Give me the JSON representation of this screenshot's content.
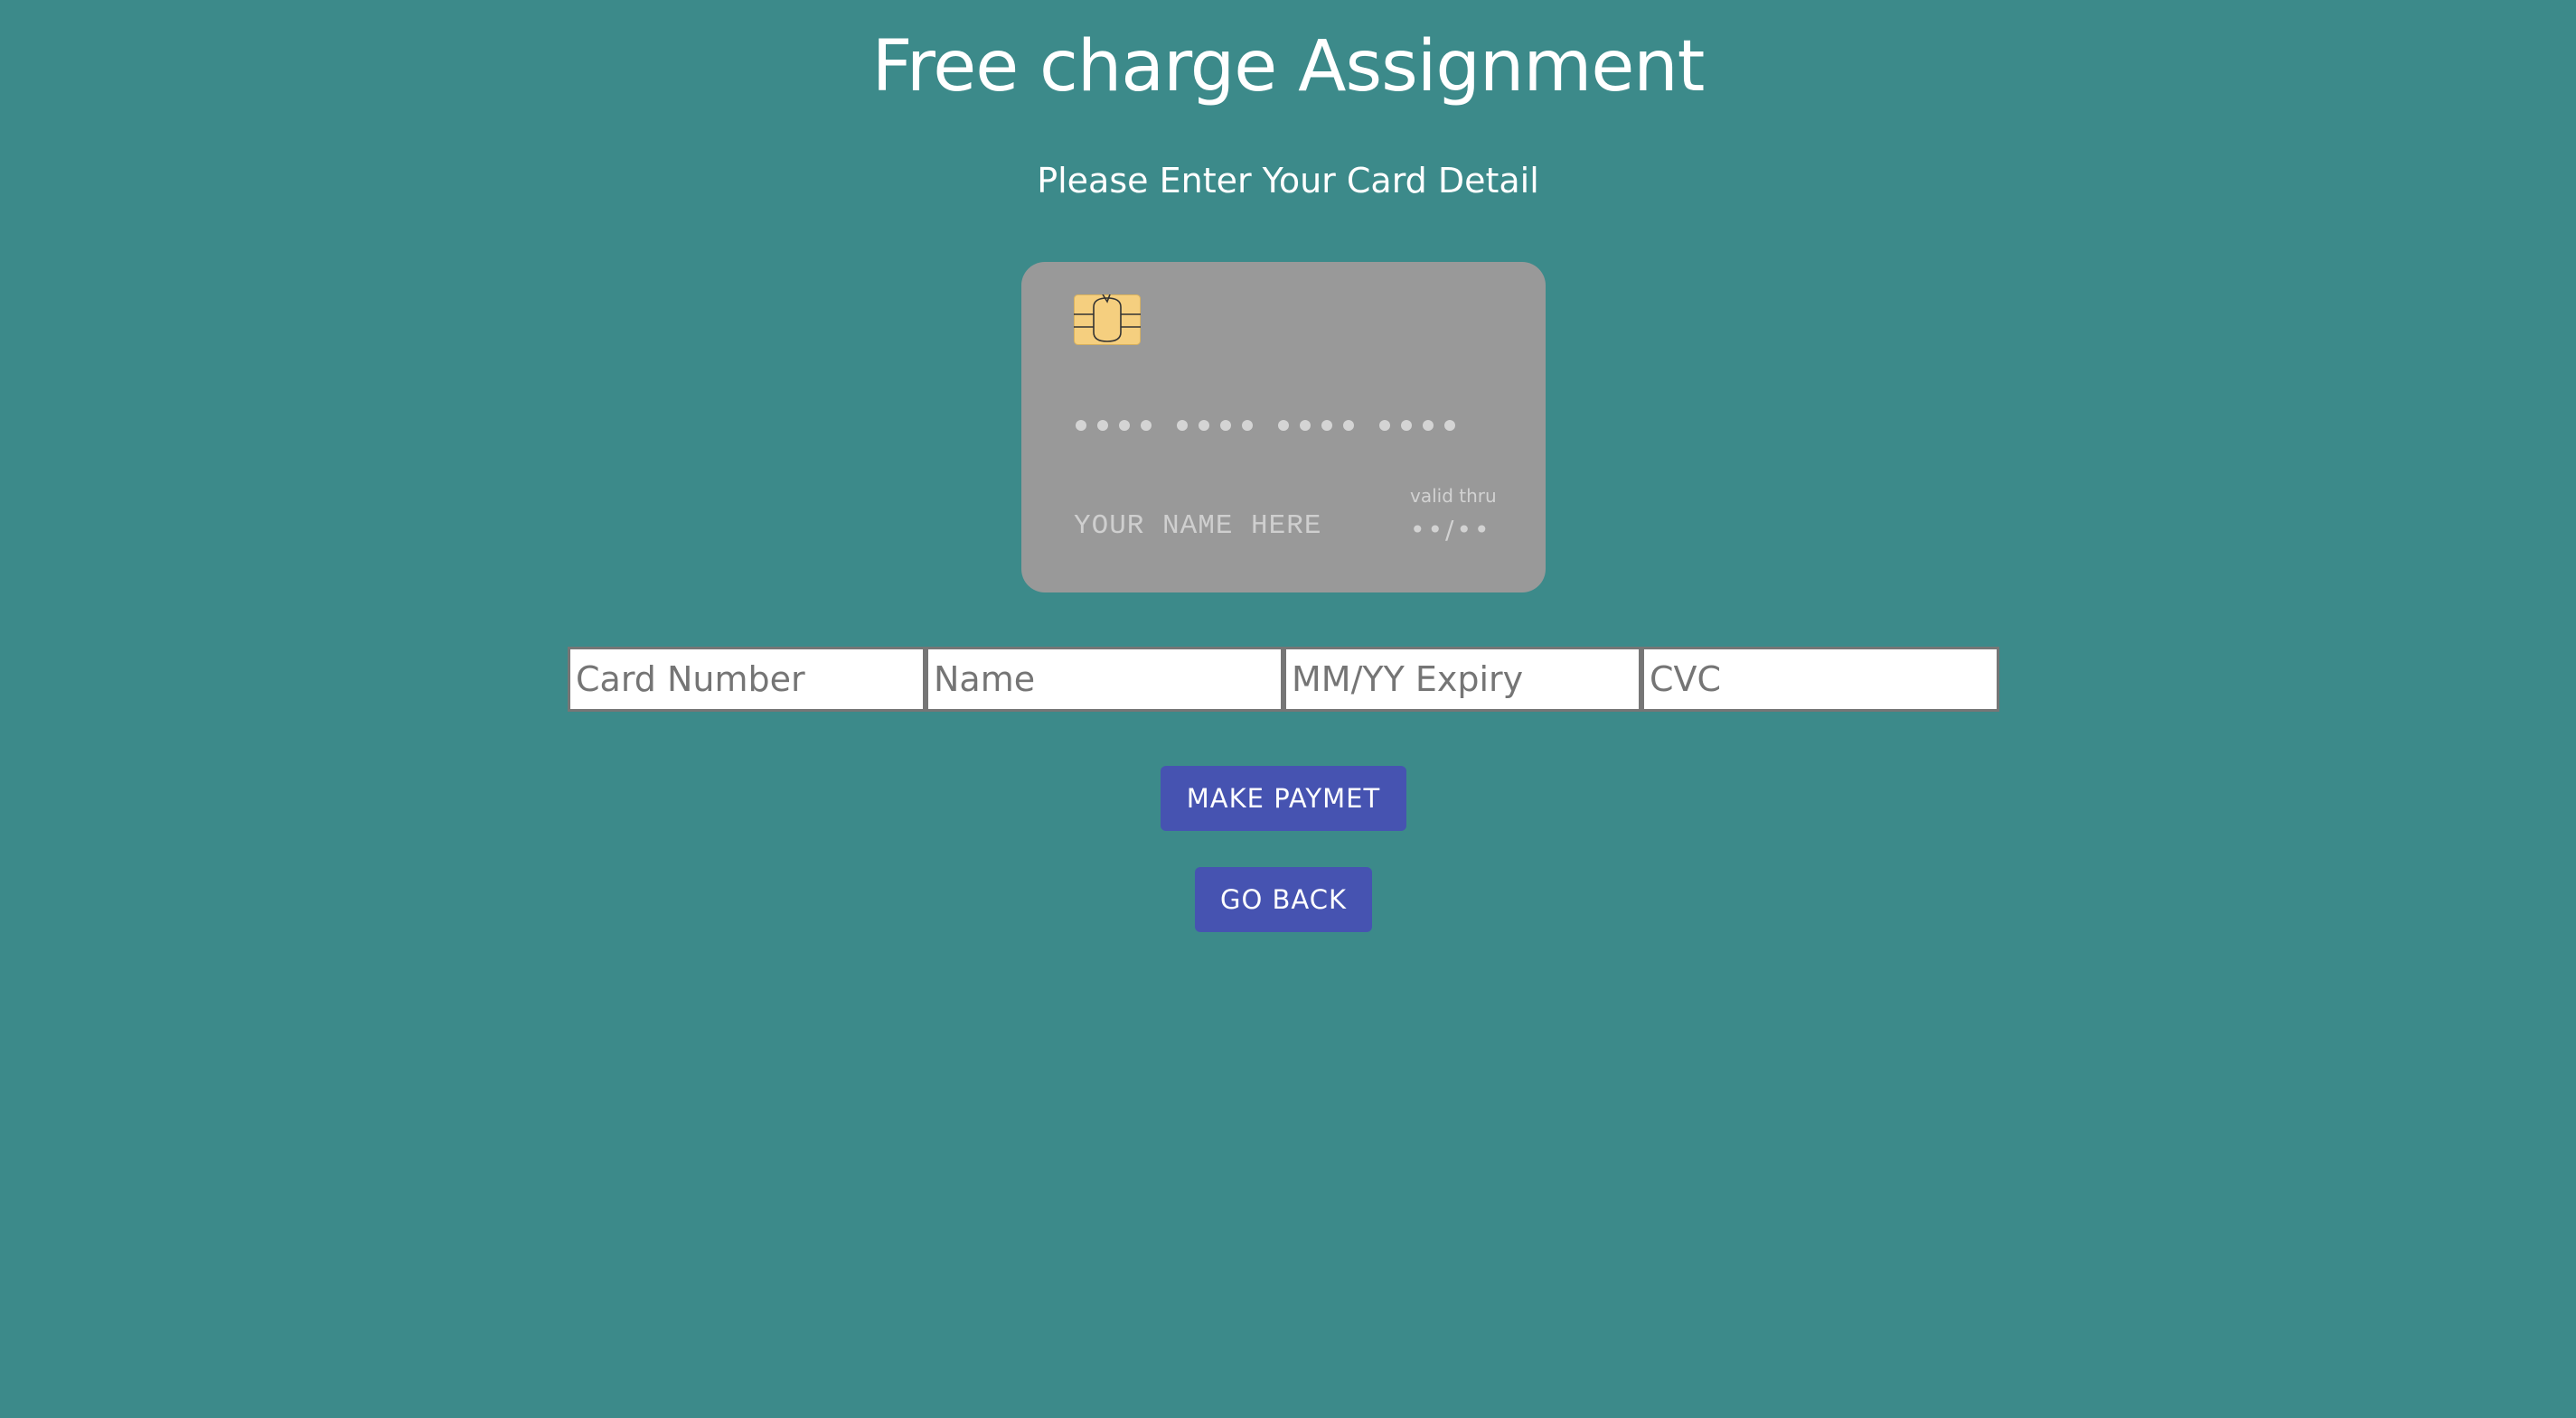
{
  "header": {
    "title": "Free charge Assignment",
    "subtitle": "Please Enter Your Card Detail"
  },
  "card_preview": {
    "chip_icon": "card-chip-icon",
    "number_placeholder_dots": "•••• •••• •••• ••••",
    "name_placeholder": "YOUR NAME HERE",
    "valid_thru_label": "valid thru",
    "expiry_placeholder": "••/••",
    "card_color": "#999999",
    "chip_color": "#f5cf7f"
  },
  "form": {
    "card_number_placeholder": "Card Number",
    "name_placeholder": "Name",
    "expiry_placeholder": "MM/YY Expiry",
    "cvc_placeholder": "CVC",
    "card_number_value": "",
    "name_value": "",
    "expiry_value": "",
    "cvc_value": ""
  },
  "actions": {
    "make_payment_label": "MAKE PAYMET",
    "go_back_label": "GO BACK"
  },
  "colors": {
    "background": "#3c8a8a",
    "button": "#4653b1",
    "text": "#ffffff"
  }
}
